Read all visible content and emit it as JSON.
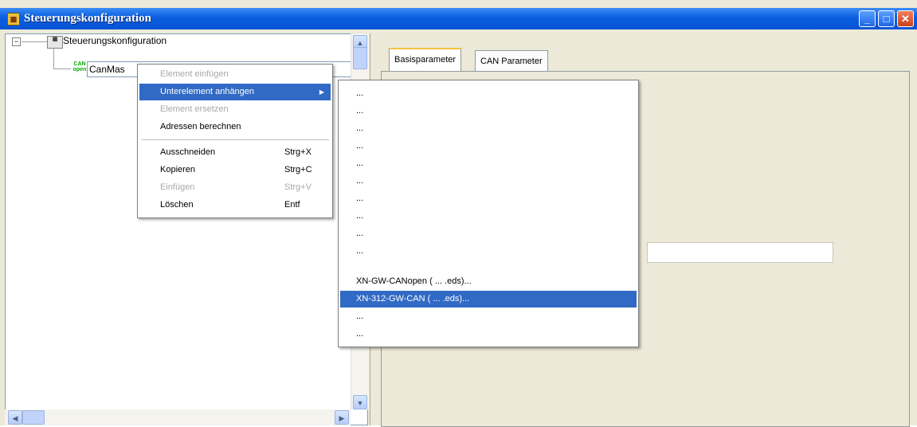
{
  "window": {
    "title": "Steuerungskonfiguration",
    "icon": "config-app-icon"
  },
  "tree": {
    "root": {
      "expander": "−",
      "label": "Steuerungskonfiguration"
    },
    "child": {
      "icon_text": "CAN open",
      "label": "CanMas"
    }
  },
  "tabs": [
    {
      "label": "Basisparameter"
    },
    {
      "label": "CAN Parameter"
    }
  ],
  "context_menu": {
    "items": [
      {
        "label": "Element einfügen",
        "shortcut": "",
        "disabled": true
      },
      {
        "label": "Unterelement anhängen",
        "shortcut": "",
        "selected": true,
        "submenu": true
      },
      {
        "label": "Element ersetzen",
        "shortcut": "",
        "disabled": true
      },
      {
        "label": "Adressen berechnen",
        "shortcut": ""
      },
      {
        "label": "Ausschneiden",
        "shortcut": "Strg+X"
      },
      {
        "label": "Kopieren",
        "shortcut": "Strg+C"
      },
      {
        "label": "Einfügen",
        "shortcut": "Strg+V",
        "disabled": true
      },
      {
        "label": "Löschen",
        "shortcut": "Entf"
      }
    ]
  },
  "submenu": {
    "items": [
      {
        "label": "..."
      },
      {
        "label": "..."
      },
      {
        "label": "..."
      },
      {
        "label": "..."
      },
      {
        "label": "..."
      },
      {
        "label": "..."
      },
      {
        "label": "..."
      },
      {
        "label": "..."
      },
      {
        "label": "..."
      },
      {
        "label": "..."
      },
      {
        "label": "XN-GW-CANopen ( ... .eds)..."
      },
      {
        "label": "XN-312-GW-CAN ( ... .eds)...",
        "selected": true
      },
      {
        "label": "..."
      },
      {
        "label": "..."
      }
    ]
  },
  "colors": {
    "menu_highlight": "#316ac5",
    "titlebar": "#0a5ee0"
  }
}
